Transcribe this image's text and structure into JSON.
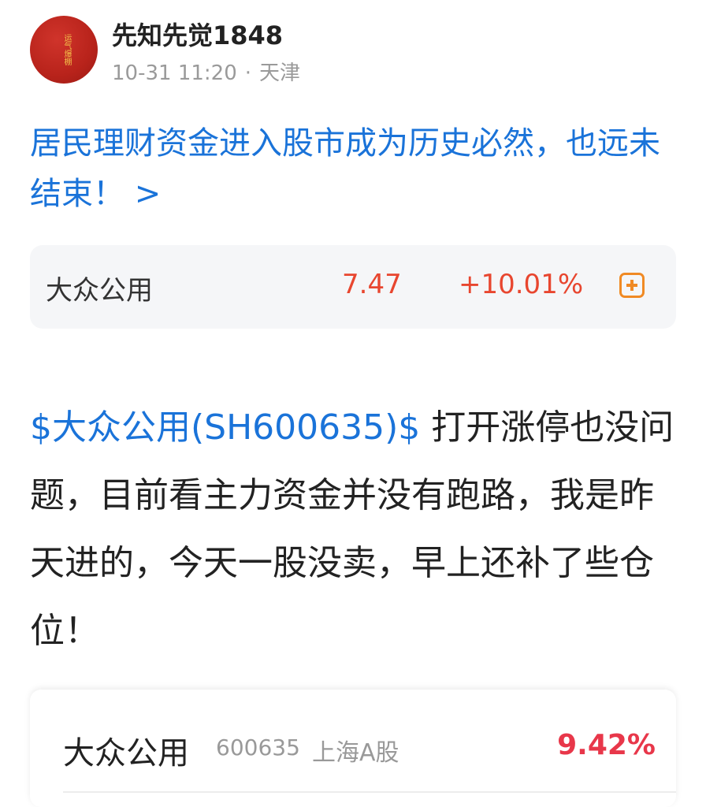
{
  "author": {
    "name": "先知先觉1848",
    "timestamp": "10-31 11:20",
    "separator": "·",
    "location": "天津",
    "avatar_text": "运气爆棚"
  },
  "headline": "居民理财资金进入股市成为历史必然，也远未结束！ >",
  "stock_card": {
    "name": "大众公用",
    "price": "7.47",
    "change": "+10.01%",
    "action_icon": "plus-square-icon"
  },
  "post": {
    "mention": "$大众公用(SH600635)$",
    "text": "  打开涨停也没问题，目前看主力资金并没有跑路，我是昨天进的，今天一股没卖，早上还补了些仓位！"
  },
  "quote_card": {
    "name": "大众公用",
    "code": "600635",
    "market": "上海A股",
    "change": "9.42%"
  },
  "colors": {
    "link": "#1a73d9",
    "up": "#e8462f",
    "up_strong": "#e8374a",
    "accent": "#f08a24"
  }
}
